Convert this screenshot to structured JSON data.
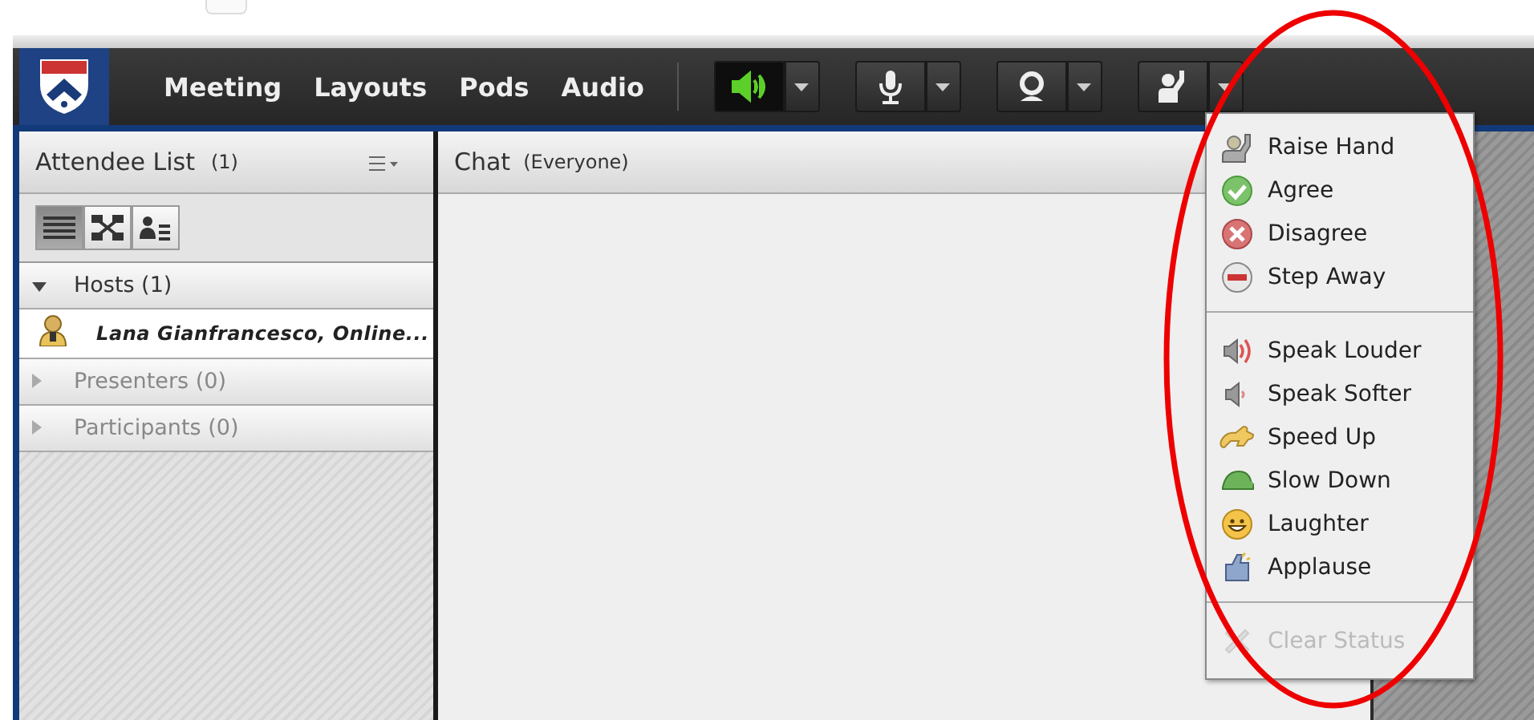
{
  "menu_bar": {
    "items": [
      "Meeting",
      "Layouts",
      "Pods",
      "Audio"
    ]
  },
  "toolbar_buttons": [
    {
      "kind": "speaker",
      "on": true
    },
    {
      "kind": "microphone",
      "on": false
    },
    {
      "kind": "camera",
      "on": false
    },
    {
      "kind": "raise-hand",
      "on": false
    }
  ],
  "attendee_pod": {
    "title": "Attendee List",
    "count": "(1)",
    "view_buttons": [
      {
        "kind": "list",
        "selected": true
      },
      {
        "kind": "tree",
        "selected": false
      },
      {
        "kind": "detail",
        "selected": false
      }
    ],
    "groups": [
      {
        "label": "Hosts (1)",
        "expanded": true,
        "children": [
          {
            "name": "Lana Gianfrancesco, Online..."
          }
        ]
      },
      {
        "label": "Presenters (0)",
        "expanded": false
      },
      {
        "label": "Participants (0)",
        "expanded": false
      }
    ]
  },
  "chat_pod": {
    "title": "Chat",
    "audience": "(Everyone)"
  },
  "status_menu": {
    "sections": [
      {
        "items": [
          {
            "label": "Raise Hand",
            "kind": "raise-hand",
            "disabled": false
          },
          {
            "label": "Agree",
            "kind": "agree",
            "disabled": false
          },
          {
            "label": "Disagree",
            "kind": "disagree",
            "disabled": false
          },
          {
            "label": "Step Away",
            "kind": "step-away",
            "disabled": false
          }
        ]
      },
      {
        "items": [
          {
            "label": "Speak Louder",
            "kind": "speak-louder",
            "disabled": false
          },
          {
            "label": "Speak Softer",
            "kind": "speak-softer",
            "disabled": false
          },
          {
            "label": "Speed Up",
            "kind": "speed-up",
            "disabled": false
          },
          {
            "label": "Slow Down",
            "kind": "slow-down",
            "disabled": false
          },
          {
            "label": "Laughter",
            "kind": "laughter",
            "disabled": false
          },
          {
            "label": "Applause",
            "kind": "applause",
            "disabled": false
          }
        ]
      },
      {
        "items": [
          {
            "label": "Clear Status",
            "kind": "clear",
            "disabled": true
          }
        ]
      }
    ]
  },
  "annotation": {
    "kind": "ellipse"
  }
}
